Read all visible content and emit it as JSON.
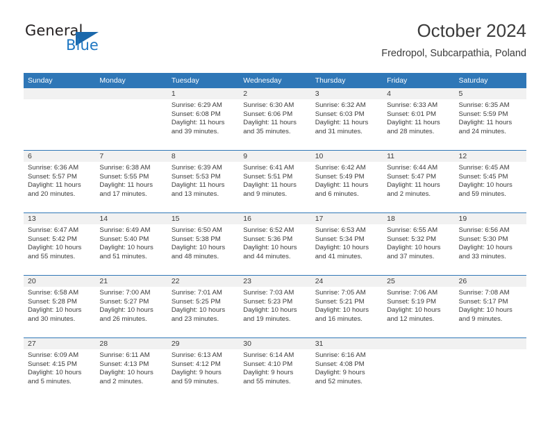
{
  "brand": {
    "name_top": "General",
    "name_bottom": "Blue",
    "accent_color": "#1b68ab",
    "logo_icon": "triangle-logo-icon"
  },
  "header": {
    "title": "October 2024",
    "subtitle": "Fredropol, Subcarpathia, Poland"
  },
  "calendar": {
    "header_bg": "#2f77b7",
    "daynum_bg": "#f1f1f1",
    "weekday_headers": [
      "Sunday",
      "Monday",
      "Tuesday",
      "Wednesday",
      "Thursday",
      "Friday",
      "Saturday"
    ],
    "weeks": [
      [
        {
          "day": "",
          "sunrise": "",
          "sunset": "",
          "daylight_line1": "",
          "daylight_line2": ""
        },
        {
          "day": "",
          "sunrise": "",
          "sunset": "",
          "daylight_line1": "",
          "daylight_line2": ""
        },
        {
          "day": "1",
          "sunrise": "Sunrise: 6:29 AM",
          "sunset": "Sunset: 6:08 PM",
          "daylight_line1": "Daylight: 11 hours",
          "daylight_line2": "and 39 minutes."
        },
        {
          "day": "2",
          "sunrise": "Sunrise: 6:30 AM",
          "sunset": "Sunset: 6:06 PM",
          "daylight_line1": "Daylight: 11 hours",
          "daylight_line2": "and 35 minutes."
        },
        {
          "day": "3",
          "sunrise": "Sunrise: 6:32 AM",
          "sunset": "Sunset: 6:03 PM",
          "daylight_line1": "Daylight: 11 hours",
          "daylight_line2": "and 31 minutes."
        },
        {
          "day": "4",
          "sunrise": "Sunrise: 6:33 AM",
          "sunset": "Sunset: 6:01 PM",
          "daylight_line1": "Daylight: 11 hours",
          "daylight_line2": "and 28 minutes."
        },
        {
          "day": "5",
          "sunrise": "Sunrise: 6:35 AM",
          "sunset": "Sunset: 5:59 PM",
          "daylight_line1": "Daylight: 11 hours",
          "daylight_line2": "and 24 minutes."
        }
      ],
      [
        {
          "day": "6",
          "sunrise": "Sunrise: 6:36 AM",
          "sunset": "Sunset: 5:57 PM",
          "daylight_line1": "Daylight: 11 hours",
          "daylight_line2": "and 20 minutes."
        },
        {
          "day": "7",
          "sunrise": "Sunrise: 6:38 AM",
          "sunset": "Sunset: 5:55 PM",
          "daylight_line1": "Daylight: 11 hours",
          "daylight_line2": "and 17 minutes."
        },
        {
          "day": "8",
          "sunrise": "Sunrise: 6:39 AM",
          "sunset": "Sunset: 5:53 PM",
          "daylight_line1": "Daylight: 11 hours",
          "daylight_line2": "and 13 minutes."
        },
        {
          "day": "9",
          "sunrise": "Sunrise: 6:41 AM",
          "sunset": "Sunset: 5:51 PM",
          "daylight_line1": "Daylight: 11 hours",
          "daylight_line2": "and 9 minutes."
        },
        {
          "day": "10",
          "sunrise": "Sunrise: 6:42 AM",
          "sunset": "Sunset: 5:49 PM",
          "daylight_line1": "Daylight: 11 hours",
          "daylight_line2": "and 6 minutes."
        },
        {
          "day": "11",
          "sunrise": "Sunrise: 6:44 AM",
          "sunset": "Sunset: 5:47 PM",
          "daylight_line1": "Daylight: 11 hours",
          "daylight_line2": "and 2 minutes."
        },
        {
          "day": "12",
          "sunrise": "Sunrise: 6:45 AM",
          "sunset": "Sunset: 5:45 PM",
          "daylight_line1": "Daylight: 10 hours",
          "daylight_line2": "and 59 minutes."
        }
      ],
      [
        {
          "day": "13",
          "sunrise": "Sunrise: 6:47 AM",
          "sunset": "Sunset: 5:42 PM",
          "daylight_line1": "Daylight: 10 hours",
          "daylight_line2": "and 55 minutes."
        },
        {
          "day": "14",
          "sunrise": "Sunrise: 6:49 AM",
          "sunset": "Sunset: 5:40 PM",
          "daylight_line1": "Daylight: 10 hours",
          "daylight_line2": "and 51 minutes."
        },
        {
          "day": "15",
          "sunrise": "Sunrise: 6:50 AM",
          "sunset": "Sunset: 5:38 PM",
          "daylight_line1": "Daylight: 10 hours",
          "daylight_line2": "and 48 minutes."
        },
        {
          "day": "16",
          "sunrise": "Sunrise: 6:52 AM",
          "sunset": "Sunset: 5:36 PM",
          "daylight_line1": "Daylight: 10 hours",
          "daylight_line2": "and 44 minutes."
        },
        {
          "day": "17",
          "sunrise": "Sunrise: 6:53 AM",
          "sunset": "Sunset: 5:34 PM",
          "daylight_line1": "Daylight: 10 hours",
          "daylight_line2": "and 41 minutes."
        },
        {
          "day": "18",
          "sunrise": "Sunrise: 6:55 AM",
          "sunset": "Sunset: 5:32 PM",
          "daylight_line1": "Daylight: 10 hours",
          "daylight_line2": "and 37 minutes."
        },
        {
          "day": "19",
          "sunrise": "Sunrise: 6:56 AM",
          "sunset": "Sunset: 5:30 PM",
          "daylight_line1": "Daylight: 10 hours",
          "daylight_line2": "and 33 minutes."
        }
      ],
      [
        {
          "day": "20",
          "sunrise": "Sunrise: 6:58 AM",
          "sunset": "Sunset: 5:28 PM",
          "daylight_line1": "Daylight: 10 hours",
          "daylight_line2": "and 30 minutes."
        },
        {
          "day": "21",
          "sunrise": "Sunrise: 7:00 AM",
          "sunset": "Sunset: 5:27 PM",
          "daylight_line1": "Daylight: 10 hours",
          "daylight_line2": "and 26 minutes."
        },
        {
          "day": "22",
          "sunrise": "Sunrise: 7:01 AM",
          "sunset": "Sunset: 5:25 PM",
          "daylight_line1": "Daylight: 10 hours",
          "daylight_line2": "and 23 minutes."
        },
        {
          "day": "23",
          "sunrise": "Sunrise: 7:03 AM",
          "sunset": "Sunset: 5:23 PM",
          "daylight_line1": "Daylight: 10 hours",
          "daylight_line2": "and 19 minutes."
        },
        {
          "day": "24",
          "sunrise": "Sunrise: 7:05 AM",
          "sunset": "Sunset: 5:21 PM",
          "daylight_line1": "Daylight: 10 hours",
          "daylight_line2": "and 16 minutes."
        },
        {
          "day": "25",
          "sunrise": "Sunrise: 7:06 AM",
          "sunset": "Sunset: 5:19 PM",
          "daylight_line1": "Daylight: 10 hours",
          "daylight_line2": "and 12 minutes."
        },
        {
          "day": "26",
          "sunrise": "Sunrise: 7:08 AM",
          "sunset": "Sunset: 5:17 PM",
          "daylight_line1": "Daylight: 10 hours",
          "daylight_line2": "and 9 minutes."
        }
      ],
      [
        {
          "day": "27",
          "sunrise": "Sunrise: 6:09 AM",
          "sunset": "Sunset: 4:15 PM",
          "daylight_line1": "Daylight: 10 hours",
          "daylight_line2": "and 5 minutes."
        },
        {
          "day": "28",
          "sunrise": "Sunrise: 6:11 AM",
          "sunset": "Sunset: 4:13 PM",
          "daylight_line1": "Daylight: 10 hours",
          "daylight_line2": "and 2 minutes."
        },
        {
          "day": "29",
          "sunrise": "Sunrise: 6:13 AM",
          "sunset": "Sunset: 4:12 PM",
          "daylight_line1": "Daylight: 9 hours",
          "daylight_line2": "and 59 minutes."
        },
        {
          "day": "30",
          "sunrise": "Sunrise: 6:14 AM",
          "sunset": "Sunset: 4:10 PM",
          "daylight_line1": "Daylight: 9 hours",
          "daylight_line2": "and 55 minutes."
        },
        {
          "day": "31",
          "sunrise": "Sunrise: 6:16 AM",
          "sunset": "Sunset: 4:08 PM",
          "daylight_line1": "Daylight: 9 hours",
          "daylight_line2": "and 52 minutes."
        },
        {
          "day": "",
          "sunrise": "",
          "sunset": "",
          "daylight_line1": "",
          "daylight_line2": ""
        },
        {
          "day": "",
          "sunrise": "",
          "sunset": "",
          "daylight_line1": "",
          "daylight_line2": ""
        }
      ]
    ]
  }
}
